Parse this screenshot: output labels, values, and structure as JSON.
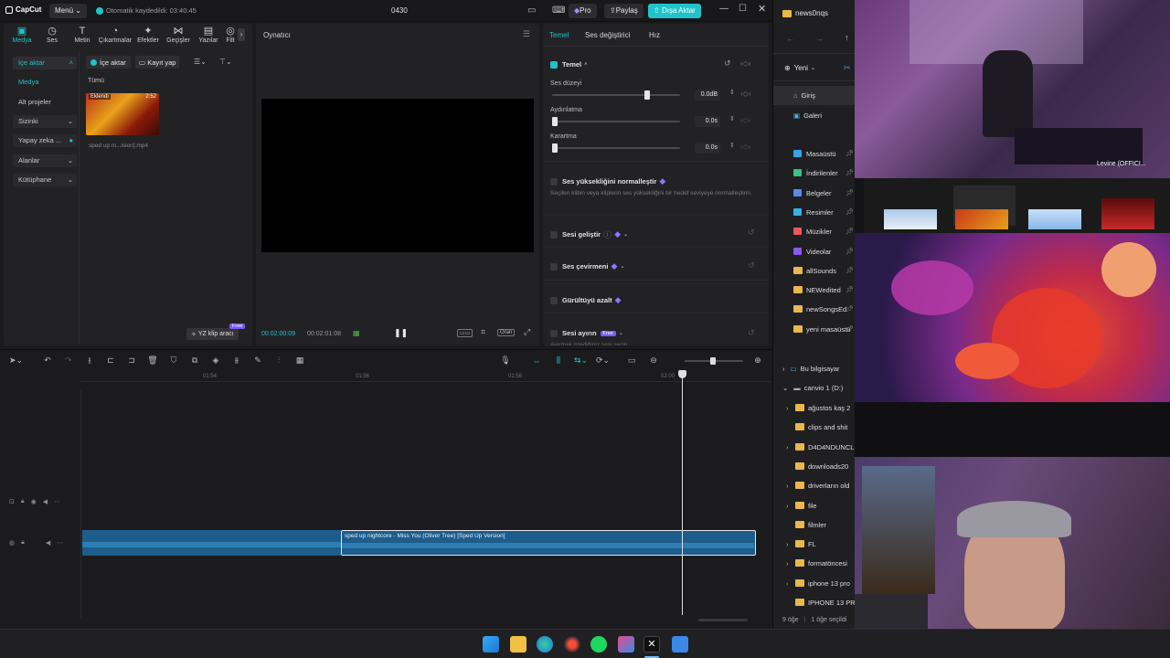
{
  "titlebar": {
    "app_name": "CapCut",
    "menu_label": "Menü",
    "autosave": "Otomatik kaydedildi: 03:40:45",
    "project_name": "0430",
    "pro_label": "Pro",
    "share_label": "Paylaş",
    "export_label": "Dışa Aktar"
  },
  "toolbar": {
    "tabs": [
      {
        "label": "Medya",
        "icon": "media-icon"
      },
      {
        "label": "Ses",
        "icon": "audio-icon"
      },
      {
        "label": "Metin",
        "icon": "text-icon"
      },
      {
        "label": "Çıkartmalar",
        "icon": "sticker-icon"
      },
      {
        "label": "Efektler",
        "icon": "effects-icon"
      },
      {
        "label": "Geçişler",
        "icon": "transitions-icon"
      },
      {
        "label": "Yazılar",
        "icon": "captions-icon"
      },
      {
        "label": "Filt",
        "icon": "filters-icon"
      }
    ]
  },
  "sidebar": {
    "items": [
      "İçe aktar",
      "Medya",
      "Alt projeler",
      "Sizinki",
      "Yapay zeka ...",
      "Alanlar",
      "Kütüphane"
    ]
  },
  "media": {
    "import_button": "İçe aktar",
    "record_button": "Kayıt yap",
    "filter_all": "Tümü",
    "clip_badge": "Eklendi",
    "clip_duration": "2:52",
    "clip_name": "sped up ni...ision].mp4",
    "ai_tool_label": "YZ klip aracı",
    "free_badge": "Free"
  },
  "player": {
    "title": "Oynatıcı",
    "current_time": "00:02:00:09",
    "total_time": "00:02:01:08",
    "ratio_label": "Oran"
  },
  "properties": {
    "tabs": [
      "Temel",
      "Ses değiştirici",
      "Hız"
    ],
    "section_basic": "Temel",
    "volume_label": "Ses düzeyi",
    "volume_value": "0.0dB",
    "volume_level": 0.74,
    "fadein_label": "Aydınlatma",
    "fadein_value": "0.0s",
    "fadeout_label": "Karartma",
    "fadeout_value": "0.0s",
    "normalize_label": "Ses yüksekliğini normalleştir",
    "normalize_desc": "Seçilen klibin veya kliplerin ses yüksekliğini bir hedef seviyeye normalleştirin.",
    "enhance_label": "Sesi geliştir",
    "convert_label": "Ses çevirmeni",
    "denoise_label": "Gürültüyü azalt",
    "isolate_label": "Sesi ayırın",
    "isolate_badge": "Free",
    "isolate_desc": "Ayırmak istediğiniz sesi seçin"
  },
  "timeline": {
    "ruler": [
      "01:54",
      "01:56",
      "01:58",
      "02:00"
    ],
    "clip_title": "sped up nightcore - Miss You (Oliver Tree) [Sped Up Version]"
  },
  "explorer": {
    "window_title": "news0nqs",
    "new_label": "Yeni",
    "home": "Giriş",
    "gallery": "Galeri",
    "pinned": [
      "Masaüstü",
      "İndirilenler",
      "Belgeler",
      "Resimler",
      "Müzikler",
      "Videolar",
      "allSounds",
      "NEWedited",
      "newSongsEd",
      "yeni masaüstü"
    ],
    "this_pc": "Bu bilgisayar",
    "drive": "canvio 1 (D:)",
    "folders": [
      "ağustos kaş 2",
      "clips and shit",
      "D4D4NDUNCL",
      "downloads20",
      "driverların old",
      "file",
      "filmler",
      "FL",
      "formatöncesi",
      "iphone 13 pro",
      "IPHONE 13 PR"
    ],
    "status_count": "9 öğe",
    "status_selected": "1 öğe seçildi"
  },
  "overlay": {
    "strip_text": "Levine (OFFICI..."
  },
  "colors": {
    "accent": "#1fc3c9",
    "export": "#1fc3c9",
    "pro": "#7a5af5",
    "audio_clip": "#1c5d8c"
  }
}
